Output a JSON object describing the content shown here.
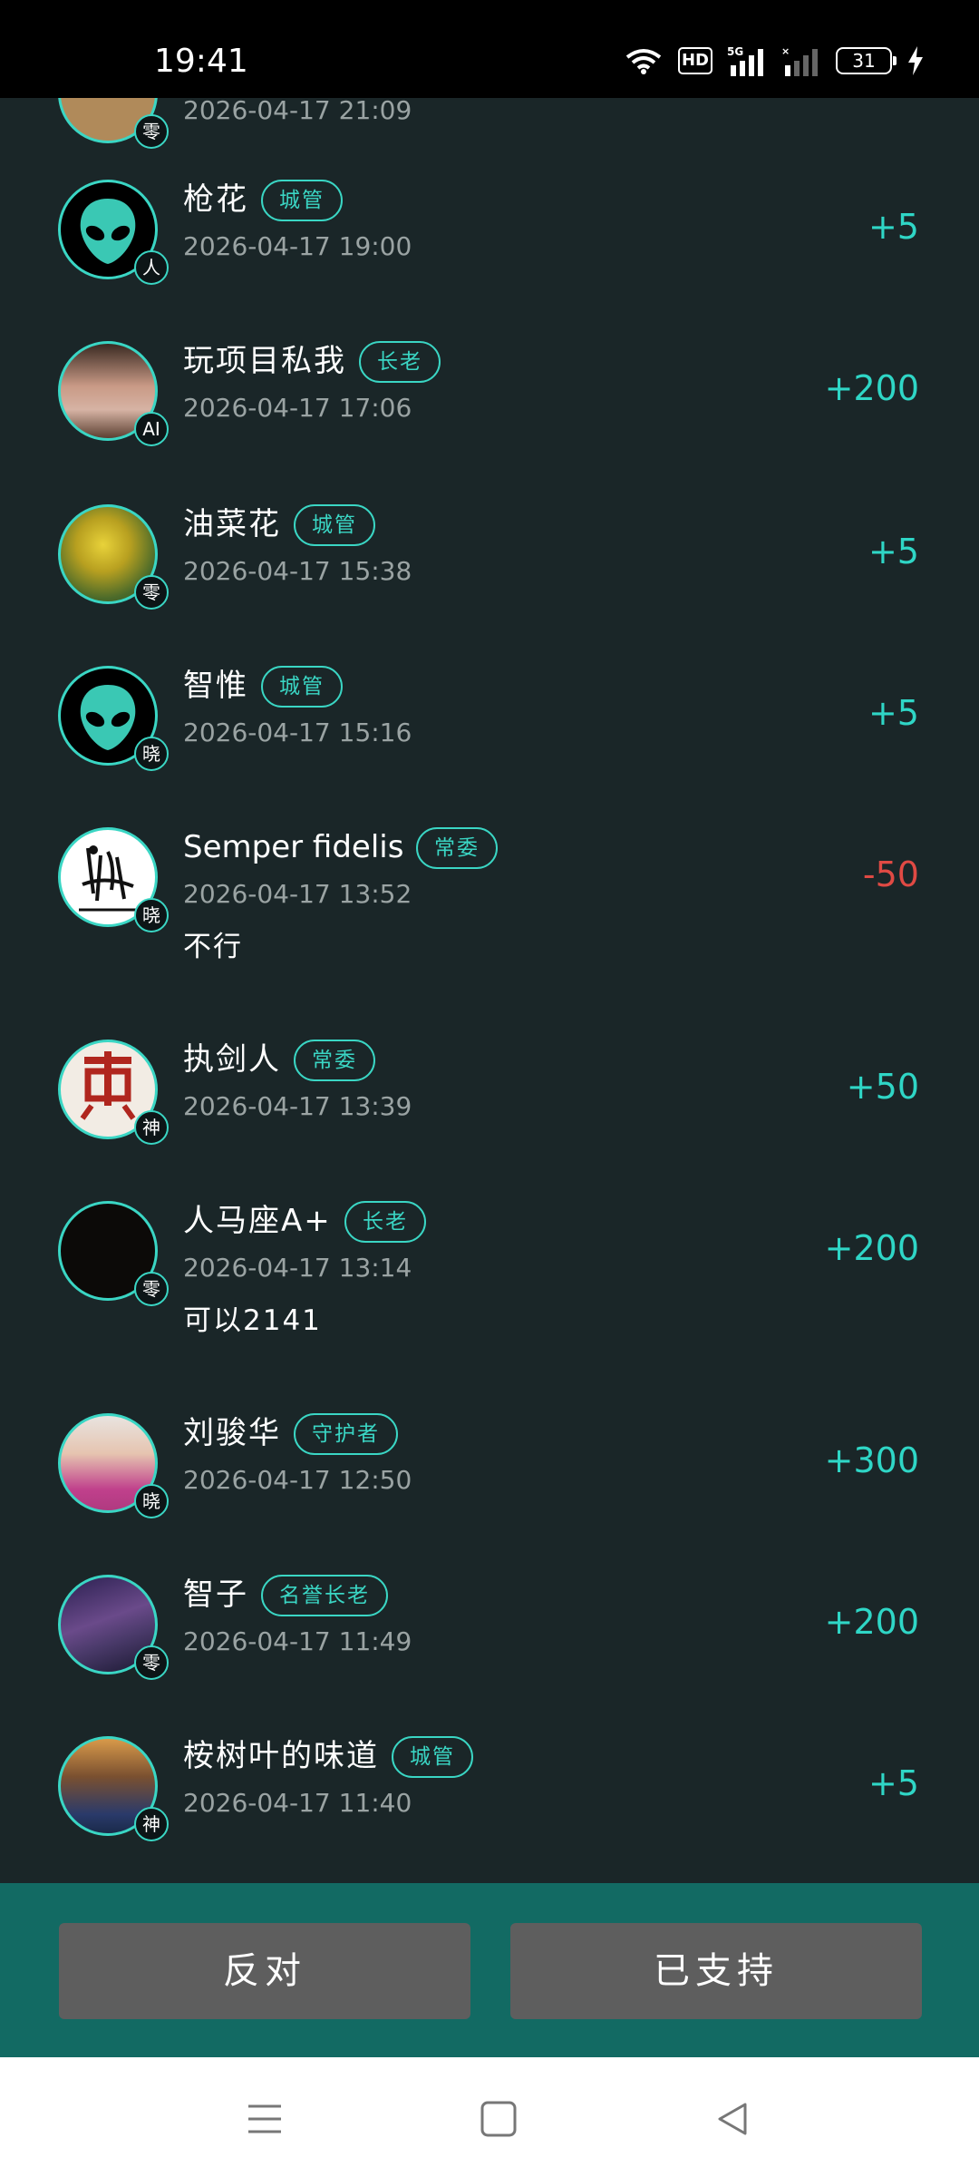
{
  "status_bar": {
    "time": "19:41",
    "hd_label": "HD",
    "battery": "31",
    "icons": [
      "wifi-icon",
      "hd-icon",
      "5g-signal-icon",
      "signal-icon",
      "battery-icon",
      "charging-icon"
    ]
  },
  "partial_entry": {
    "rank": "零",
    "date": "2026-04-17 21:09"
  },
  "entries": [
    {
      "name": "枪花",
      "role": "城管",
      "date": "2026-04-17 19:00",
      "amount": "+5",
      "rank": "人",
      "avatar": "alien-icon",
      "comment": ""
    },
    {
      "name": "玩项目私我",
      "role": "长老",
      "date": "2026-04-17 17:06",
      "amount": "+200",
      "rank": "AI",
      "avatar": "portrait-woman",
      "comment": ""
    },
    {
      "name": "油菜花",
      "role": "城管",
      "date": "2026-04-17 15:38",
      "amount": "+5",
      "rank": "零",
      "avatar": "rapeseed-flower",
      "comment": ""
    },
    {
      "name": "智惟",
      "role": "城管",
      "date": "2026-04-17 15:16",
      "amount": "+5",
      "rank": "晓",
      "avatar": "alien-icon",
      "comment": ""
    },
    {
      "name": "Semper fidelis",
      "role": "常委",
      "date": "2026-04-17 13:52",
      "amount": "-50",
      "rank": "晓",
      "avatar": "don-quixote-sketch",
      "comment": "不行"
    },
    {
      "name": "执剑人",
      "role": "常委",
      "date": "2026-04-17 13:39",
      "amount": "+50",
      "rank": "神",
      "avatar": "huang-calligraphy",
      "comment": ""
    },
    {
      "name": "人马座A+",
      "role": "长老",
      "date": "2026-04-17 13:14",
      "amount": "+200",
      "rank": "零",
      "avatar": "night-sky",
      "comment": "可以2141"
    },
    {
      "name": "刘骏华",
      "role": "守护者",
      "date": "2026-04-17 12:50",
      "amount": "+300",
      "rank": "晓",
      "avatar": "portrait-man",
      "comment": ""
    },
    {
      "name": "智子",
      "role": "名誉长老",
      "date": "2026-04-17 11:49",
      "amount": "+200",
      "rank": "零",
      "avatar": "milky-way",
      "comment": ""
    },
    {
      "name": "桉树叶的味道",
      "role": "城管",
      "date": "2026-04-17 11:40",
      "amount": "+5",
      "rank": "神",
      "avatar": "skeleton-figure",
      "comment": ""
    }
  ],
  "actions": {
    "oppose": "反对",
    "support": "已支持"
  },
  "nav": [
    "menu-icon",
    "home-icon",
    "back-icon"
  ],
  "colors": {
    "background": "#1a2628",
    "accent": "#3ad6c4",
    "positive": "#2fd6c6",
    "negative": "#e04a44",
    "action_bar": "#126a63",
    "button": "#5e5e5e"
  }
}
